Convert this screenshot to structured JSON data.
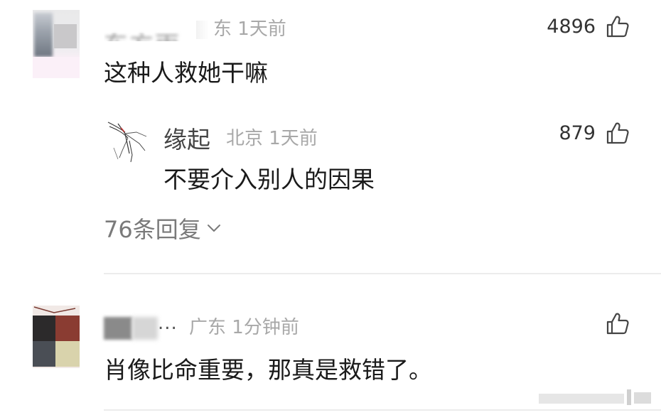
{
  "comments": [
    {
      "username": "东方雨",
      "location": "东",
      "time": "1天前",
      "likes": "4896",
      "text": "这种人救她干嘛",
      "reply": {
        "username": "缘起",
        "location": "北京",
        "time": "1天前",
        "likes": "879",
        "text": "不要介入别人的因果"
      },
      "more_replies": "76条回复"
    },
    {
      "username_suffix": "...",
      "location": "广东",
      "time": "1分钟前",
      "text": "肖像比命重要，那真是救错了。"
    }
  ],
  "icons": {
    "like": "thumbs-up-icon",
    "expand": "chevron-down-icon"
  },
  "colors": {
    "text_primary": "#1a1a1a",
    "text_meta": "#a8a8a8",
    "text_secondary": "#7a7a7a",
    "divider": "#ececec"
  }
}
